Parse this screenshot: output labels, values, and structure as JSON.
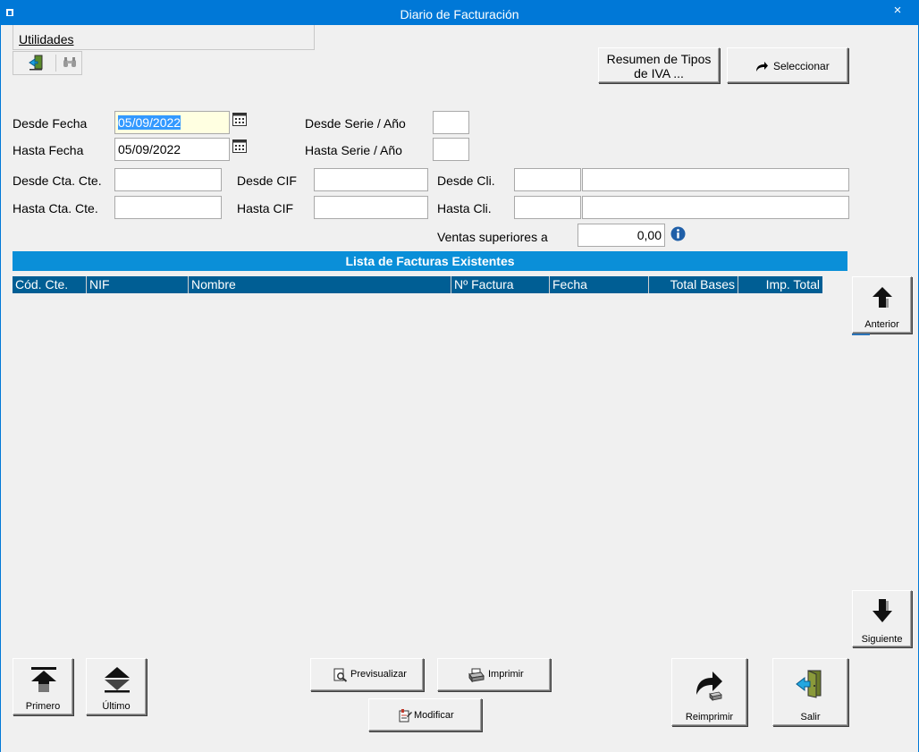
{
  "window": {
    "title": "Diario de Facturación",
    "close_glyph": "×"
  },
  "menu": {
    "utilidades": "Utilidades"
  },
  "toolbar": {
    "exit_icon": "exit-door-icon",
    "find_icon": "binoculars-icon"
  },
  "top_buttons": {
    "resumen": "Resumen de Tipos de IVA ...",
    "seleccionar": "Seleccionar"
  },
  "filters": {
    "desde_fecha_label": "Desde Fecha",
    "desde_fecha_value": "05/09/2022",
    "hasta_fecha_label": "Hasta Fecha",
    "hasta_fecha_value": "05/09/2022",
    "desde_serie_label": "Desde Serie / Año",
    "hasta_serie_label": "Hasta Serie / Año",
    "desde_cta_label": "Desde Cta. Cte.",
    "hasta_cta_label": "Hasta Cta. Cte.",
    "desde_cif_label": "Desde CIF",
    "hasta_cif_label": "Hasta CIF",
    "desde_cli_label": "Desde Cli.",
    "hasta_cli_label": "Hasta Cli.",
    "ventas_label": "Ventas superiores a",
    "ventas_value": "0,00"
  },
  "list": {
    "title": "Lista de Facturas Existentes",
    "columns": [
      "Cód. Cte.",
      "NIF",
      "Nombre",
      "Nº Factura",
      "Fecha",
      "Total Bases",
      "Imp. Total"
    ]
  },
  "nav": {
    "anterior": "Anterior",
    "siguiente": "Siguiente",
    "primero": "Primero",
    "ultimo": "Último"
  },
  "actions": {
    "previsualizar": "Previsualizar",
    "imprimir": "Imprimir",
    "modificar": "Modificar",
    "reimprimir": "Reimprimir",
    "salir": "Salir"
  }
}
